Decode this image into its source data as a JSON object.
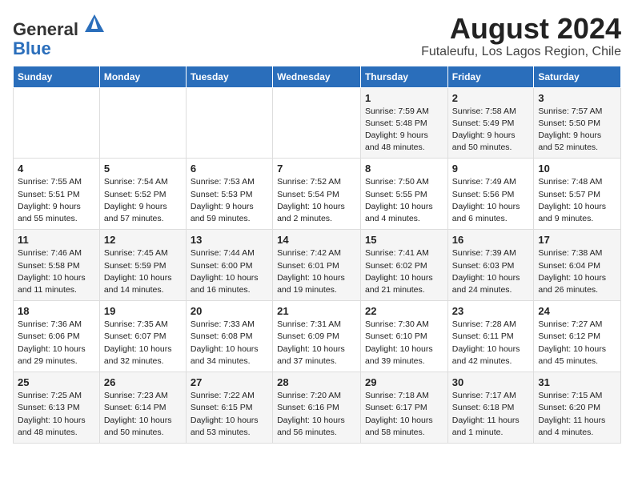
{
  "header": {
    "logo_line1": "General",
    "logo_line2": "Blue",
    "title": "August 2024",
    "subtitle": "Futaleufu, Los Lagos Region, Chile"
  },
  "weekdays": [
    "Sunday",
    "Monday",
    "Tuesday",
    "Wednesday",
    "Thursday",
    "Friday",
    "Saturday"
  ],
  "weeks": [
    [
      {
        "day": "",
        "info": ""
      },
      {
        "day": "",
        "info": ""
      },
      {
        "day": "",
        "info": ""
      },
      {
        "day": "",
        "info": ""
      },
      {
        "day": "1",
        "info": "Sunrise: 7:59 AM\nSunset: 5:48 PM\nDaylight: 9 hours\nand 48 minutes."
      },
      {
        "day": "2",
        "info": "Sunrise: 7:58 AM\nSunset: 5:49 PM\nDaylight: 9 hours\nand 50 minutes."
      },
      {
        "day": "3",
        "info": "Sunrise: 7:57 AM\nSunset: 5:50 PM\nDaylight: 9 hours\nand 52 minutes."
      }
    ],
    [
      {
        "day": "4",
        "info": "Sunrise: 7:55 AM\nSunset: 5:51 PM\nDaylight: 9 hours\nand 55 minutes."
      },
      {
        "day": "5",
        "info": "Sunrise: 7:54 AM\nSunset: 5:52 PM\nDaylight: 9 hours\nand 57 minutes."
      },
      {
        "day": "6",
        "info": "Sunrise: 7:53 AM\nSunset: 5:53 PM\nDaylight: 9 hours\nand 59 minutes."
      },
      {
        "day": "7",
        "info": "Sunrise: 7:52 AM\nSunset: 5:54 PM\nDaylight: 10 hours\nand 2 minutes."
      },
      {
        "day": "8",
        "info": "Sunrise: 7:50 AM\nSunset: 5:55 PM\nDaylight: 10 hours\nand 4 minutes."
      },
      {
        "day": "9",
        "info": "Sunrise: 7:49 AM\nSunset: 5:56 PM\nDaylight: 10 hours\nand 6 minutes."
      },
      {
        "day": "10",
        "info": "Sunrise: 7:48 AM\nSunset: 5:57 PM\nDaylight: 10 hours\nand 9 minutes."
      }
    ],
    [
      {
        "day": "11",
        "info": "Sunrise: 7:46 AM\nSunset: 5:58 PM\nDaylight: 10 hours\nand 11 minutes."
      },
      {
        "day": "12",
        "info": "Sunrise: 7:45 AM\nSunset: 5:59 PM\nDaylight: 10 hours\nand 14 minutes."
      },
      {
        "day": "13",
        "info": "Sunrise: 7:44 AM\nSunset: 6:00 PM\nDaylight: 10 hours\nand 16 minutes."
      },
      {
        "day": "14",
        "info": "Sunrise: 7:42 AM\nSunset: 6:01 PM\nDaylight: 10 hours\nand 19 minutes."
      },
      {
        "day": "15",
        "info": "Sunrise: 7:41 AM\nSunset: 6:02 PM\nDaylight: 10 hours\nand 21 minutes."
      },
      {
        "day": "16",
        "info": "Sunrise: 7:39 AM\nSunset: 6:03 PM\nDaylight: 10 hours\nand 24 minutes."
      },
      {
        "day": "17",
        "info": "Sunrise: 7:38 AM\nSunset: 6:04 PM\nDaylight: 10 hours\nand 26 minutes."
      }
    ],
    [
      {
        "day": "18",
        "info": "Sunrise: 7:36 AM\nSunset: 6:06 PM\nDaylight: 10 hours\nand 29 minutes."
      },
      {
        "day": "19",
        "info": "Sunrise: 7:35 AM\nSunset: 6:07 PM\nDaylight: 10 hours\nand 32 minutes."
      },
      {
        "day": "20",
        "info": "Sunrise: 7:33 AM\nSunset: 6:08 PM\nDaylight: 10 hours\nand 34 minutes."
      },
      {
        "day": "21",
        "info": "Sunrise: 7:31 AM\nSunset: 6:09 PM\nDaylight: 10 hours\nand 37 minutes."
      },
      {
        "day": "22",
        "info": "Sunrise: 7:30 AM\nSunset: 6:10 PM\nDaylight: 10 hours\nand 39 minutes."
      },
      {
        "day": "23",
        "info": "Sunrise: 7:28 AM\nSunset: 6:11 PM\nDaylight: 10 hours\nand 42 minutes."
      },
      {
        "day": "24",
        "info": "Sunrise: 7:27 AM\nSunset: 6:12 PM\nDaylight: 10 hours\nand 45 minutes."
      }
    ],
    [
      {
        "day": "25",
        "info": "Sunrise: 7:25 AM\nSunset: 6:13 PM\nDaylight: 10 hours\nand 48 minutes."
      },
      {
        "day": "26",
        "info": "Sunrise: 7:23 AM\nSunset: 6:14 PM\nDaylight: 10 hours\nand 50 minutes."
      },
      {
        "day": "27",
        "info": "Sunrise: 7:22 AM\nSunset: 6:15 PM\nDaylight: 10 hours\nand 53 minutes."
      },
      {
        "day": "28",
        "info": "Sunrise: 7:20 AM\nSunset: 6:16 PM\nDaylight: 10 hours\nand 56 minutes."
      },
      {
        "day": "29",
        "info": "Sunrise: 7:18 AM\nSunset: 6:17 PM\nDaylight: 10 hours\nand 58 minutes."
      },
      {
        "day": "30",
        "info": "Sunrise: 7:17 AM\nSunset: 6:18 PM\nDaylight: 11 hours\nand 1 minute."
      },
      {
        "day": "31",
        "info": "Sunrise: 7:15 AM\nSunset: 6:20 PM\nDaylight: 11 hours\nand 4 minutes."
      }
    ]
  ]
}
